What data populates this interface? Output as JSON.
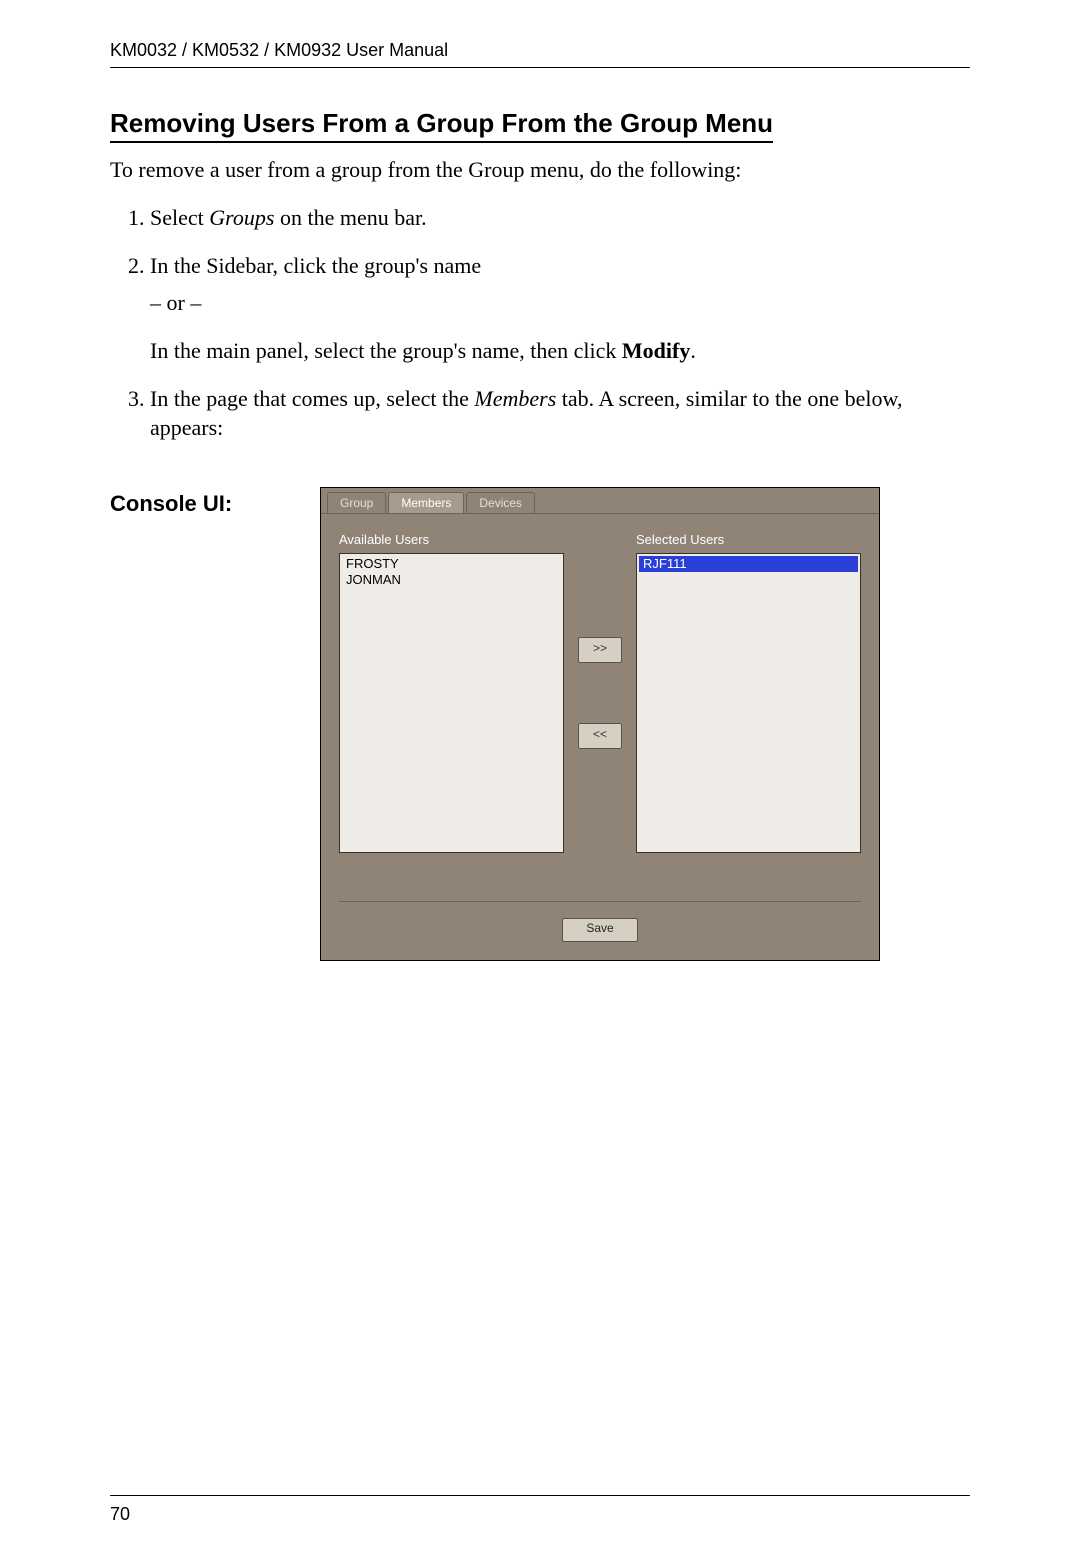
{
  "header": {
    "running": "KM0032 / KM0532 / KM0932 User Manual"
  },
  "section": {
    "title": "Removing Users From a Group From the Group Menu",
    "intro": "To remove a user from a group from the Group menu, do the following:"
  },
  "steps": {
    "s1_prefix": "Select ",
    "s1_em": "Groups",
    "s1_suffix": " on the menu bar.",
    "s2_line1": "In the Sidebar, click the group's name",
    "s2_or": "– or –",
    "s2_line2_prefix": "In the main panel, select the group's name, then click ",
    "s2_line2_bold": "Modify",
    "s2_line2_suffix": ".",
    "s3_prefix": "In the page that comes up, select the ",
    "s3_em": "Members",
    "s3_suffix": " tab. A screen, similar to the one below, appears:"
  },
  "console_label": "Console UI:",
  "console": {
    "tabs": {
      "group": "Group",
      "members": "Members",
      "devices": "Devices"
    },
    "available_label": "Available Users",
    "selected_label": "Selected Users",
    "available_users": [
      "FROSTY",
      "JONMAN"
    ],
    "selected_users": [
      {
        "name": "RJF111",
        "selected": true
      }
    ],
    "move_right": ">>",
    "move_left": "<<",
    "save": "Save"
  },
  "footer": {
    "page_number": "70"
  }
}
